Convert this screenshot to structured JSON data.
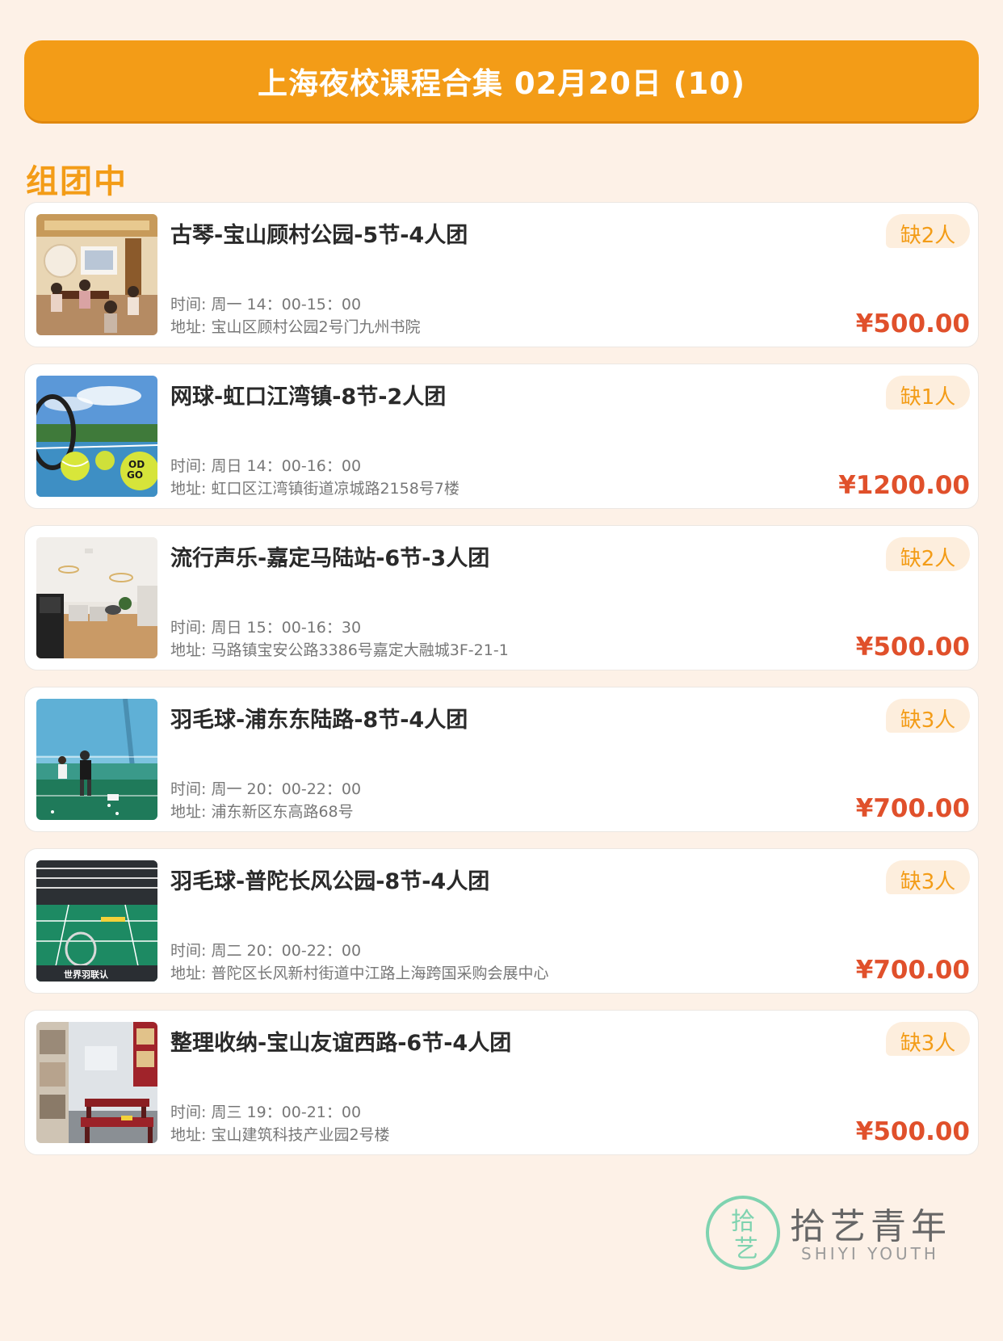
{
  "header": {
    "title": "上海夜校课程合集 02月20日 (10)"
  },
  "section": {
    "title": "组团中"
  },
  "courses": [
    {
      "title": "古琴-宝山顾村公园-5节-4人团",
      "time": "时间: 周一 14：00-15：00",
      "address": "地址: 宝山区顾村公园2号门九州书院",
      "badge": "缺2人",
      "price": "¥500.00"
    },
    {
      "title": "网球-虹口江湾镇-8节-2人团",
      "time": "时间: 周日 14：00-16：00",
      "address": "地址: 虹口区江湾镇街道凉城路2158号7楼",
      "badge": "缺1人",
      "price": "¥1200.00"
    },
    {
      "title": "流行声乐-嘉定马陆站-6节-3人团",
      "time": "时间: 周日 15：00-16：30",
      "address": "地址: 马路镇宝安公路3386号嘉定大融城3F-21-1",
      "badge": "缺2人",
      "price": "¥500.00"
    },
    {
      "title": "羽毛球-浦东东陆路-8节-4人团",
      "time": "时间: 周一 20：00-22：00",
      "address": "地址: 浦东新区东高路68号",
      "badge": "缺3人",
      "price": "¥700.00"
    },
    {
      "title": "羽毛球-普陀长风公园-8节-4人团",
      "time": "时间: 周二 20：00-22：00",
      "address": "地址: 普陀区长风新村街道中江路上海跨国采购会展中心",
      "badge": "缺3人",
      "price": "¥700.00"
    },
    {
      "title": "整理收纳-宝山友谊西路-6节-4人团",
      "time": "时间: 周三 19：00-21：00",
      "address": "地址: 宝山建筑科技产业园2号楼",
      "badge": "缺3人",
      "price": "¥500.00"
    }
  ],
  "brand": {
    "name_cn": "拾艺青年",
    "name_en": "SHIYI YOUTH",
    "mark_text": "拾艺",
    "accent": "#f39c17",
    "price_color": "#e0502b",
    "logo_color": "#7fd3b0"
  }
}
